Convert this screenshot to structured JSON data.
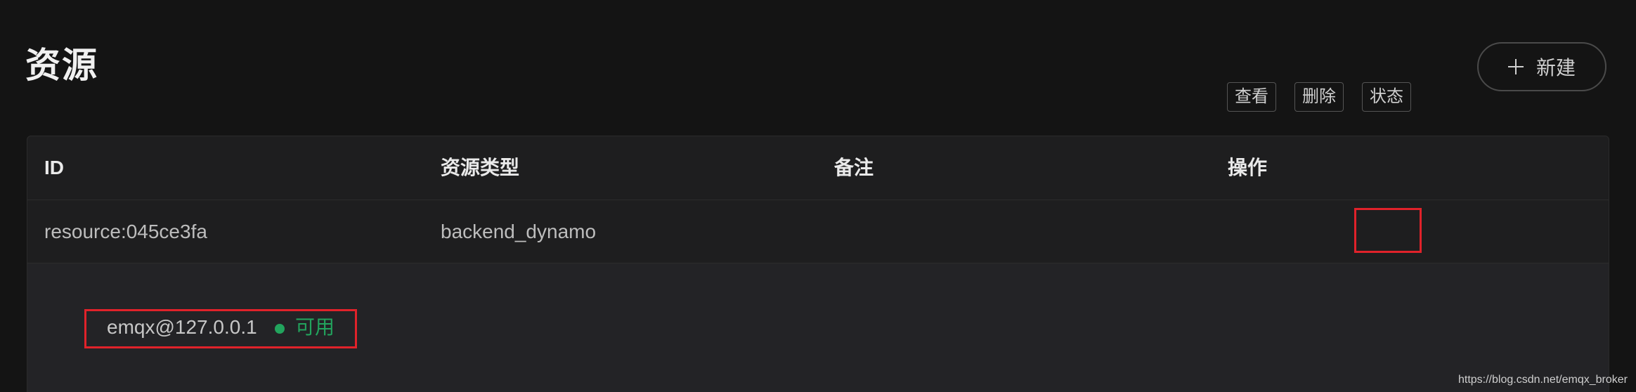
{
  "page": {
    "title": "资源",
    "new_button_label": "新建"
  },
  "table": {
    "headers": [
      "ID",
      "资源类型",
      "备注",
      "操作"
    ],
    "rows": [
      {
        "id": "resource:045ce3fa",
        "type": "backend_dynamo",
        "note": "",
        "actions": [
          "查看",
          "删除",
          "状态"
        ]
      }
    ]
  },
  "expanded": {
    "node": "emqx@127.0.0.1",
    "status": "可用"
  },
  "colors": {
    "status_ok": "#22a45d",
    "highlight": "#e0222a"
  },
  "watermark": "https://blog.csdn.net/emqx_broker"
}
